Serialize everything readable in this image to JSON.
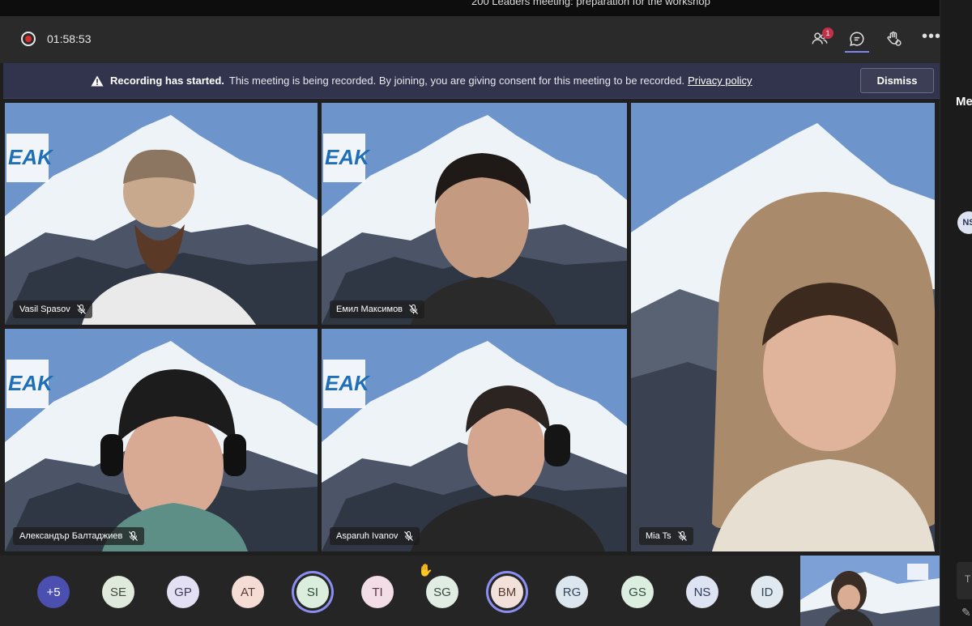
{
  "window": {
    "title": "200 Leaders meeting: preparation for the workshop"
  },
  "toolbar": {
    "timer": "01:58:53",
    "participants_badge": "1",
    "more": "•••",
    "icons": [
      "record-icon",
      "participants-icon",
      "chat-icon",
      "reactions-icon",
      "more-icon"
    ]
  },
  "banner": {
    "bold": "Recording has started.",
    "message": "This meeting is being recorded. By joining, you are giving consent for this meeting to be recorded.",
    "link": "Privacy policy",
    "dismiss": "Dismiss"
  },
  "side_panel": {
    "title": "Me",
    "avatar": "NS",
    "input_hint": "T"
  },
  "tiles": [
    {
      "name": "Vasil Spasov",
      "logo": "EAK"
    },
    {
      "name": "Емил Максимов",
      "logo": "EAK"
    },
    {
      "name": "Mia Ts"
    },
    {
      "name": "Александър Балтаджиев",
      "logo": "EAK"
    },
    {
      "name": "Asparuh Ivanov",
      "logo": "EAK"
    }
  ],
  "participants": [
    {
      "initials": "+5",
      "bg": "#4b4fb0",
      "fg": "#ffffff"
    },
    {
      "initials": "SE",
      "bg": "#dfe9dc",
      "fg": "#3b4a37"
    },
    {
      "initials": "GP",
      "bg": "#e3e0f3",
      "fg": "#3c3856"
    },
    {
      "initials": "AT",
      "bg": "#f5ddd6",
      "fg": "#5a3a31"
    },
    {
      "initials": "SI",
      "bg": "#dbeedd",
      "fg": "#2e4b33",
      "active": true
    },
    {
      "initials": "TI",
      "bg": "#f3dde6",
      "fg": "#5a3546"
    },
    {
      "initials": "SG",
      "bg": "#e1ece3",
      "fg": "#384a3c",
      "hand": true
    },
    {
      "initials": "BM",
      "bg": "#f1e1da",
      "fg": "#57392e",
      "active": true
    },
    {
      "initials": "RG",
      "bg": "#dbe6ee",
      "fg": "#33465a"
    },
    {
      "initials": "GS",
      "bg": "#dceee0",
      "fg": "#2f4c36"
    },
    {
      "initials": "NS",
      "bg": "#dde3f2",
      "fg": "#2e3a5b"
    },
    {
      "initials": "ID",
      "bg": "#dfe9ef",
      "fg": "#34475a"
    }
  ],
  "colors": {
    "accent": "#8b8ef0",
    "banner": "#31344c",
    "recording": "#d92c2c"
  }
}
